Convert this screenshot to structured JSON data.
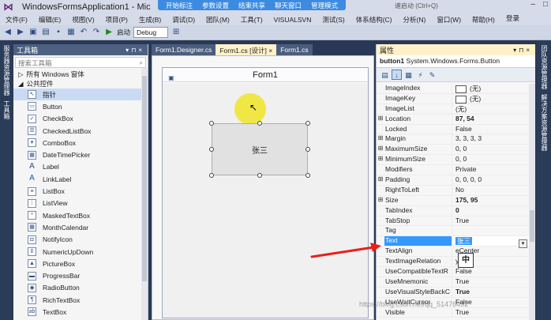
{
  "window": {
    "title": "WindowsFormsApplication1 - Mic",
    "quick_launch": "速启动 (Ctrl+Q)",
    "login": "登录",
    "win_controls": [
      "–",
      "□"
    ]
  },
  "screen_share_toolbar": [
    "开始标注",
    "参数设置",
    "结束共享",
    "聊天窗口",
    "管理模式"
  ],
  "menu": [
    "文件(F)",
    "编辑(E)",
    "视图(V)",
    "项目(P)",
    "生成(B)",
    "调试(D)",
    "团队(M)",
    "工具(T)",
    "VISUALSVN",
    "测试(S)",
    "体系结构(C)",
    "分析(N)",
    "窗口(W)",
    "帮助(H)"
  ],
  "toolbar": {
    "start_label": "启动",
    "config": "Debug"
  },
  "left_rail": [
    "服务器资源管理器",
    "工具箱"
  ],
  "right_rail": [
    "团队资源管理器",
    "解决方案资源管理器"
  ],
  "toolbox": {
    "title": "工具箱",
    "search_placeholder": "搜索工具箱",
    "groups": [
      "所有 Windows 窗体",
      "公共控件"
    ],
    "items": [
      "指针",
      "Button",
      "CheckBox",
      "CheckedListBox",
      "ComboBox",
      "DateTimePicker",
      "Label",
      "LinkLabel",
      "ListBox",
      "ListView",
      "MaskedTextBox",
      "MonthCalendar",
      "NotifyIcon",
      "NumericUpDown",
      "PictureBox",
      "ProgressBar",
      "RadioButton",
      "RichTextBox",
      "TextBox"
    ]
  },
  "doc_tabs": [
    "Form1.Designer.cs",
    "Form1.cs [设计]",
    "Form1.cs"
  ],
  "tab_close": "×",
  "form": {
    "title": "Form1",
    "button_text": "张三"
  },
  "properties": {
    "title": "属性",
    "object": "button1",
    "object_type": "System.Windows.Forms.Button",
    "rows": [
      {
        "name": "ImageIndex",
        "value": "(无)",
        "swatch": true,
        "exp": ""
      },
      {
        "name": "ImageKey",
        "value": "(无)",
        "swatch": true,
        "exp": ""
      },
      {
        "name": "ImageList",
        "value": "(无)",
        "exp": ""
      },
      {
        "name": "Location",
        "value": "87, 54",
        "bold": true,
        "exp": "⊞"
      },
      {
        "name": "Locked",
        "value": "False",
        "exp": ""
      },
      {
        "name": "Margin",
        "value": "3, 3, 3, 3",
        "exp": "⊞"
      },
      {
        "name": "MaximumSize",
        "value": "0, 0",
        "exp": "⊞"
      },
      {
        "name": "MinimumSize",
        "value": "0, 0",
        "exp": "⊞"
      },
      {
        "name": "Modifiers",
        "value": "Private",
        "exp": ""
      },
      {
        "name": "Padding",
        "value": "0, 0, 0, 0",
        "exp": "⊞"
      },
      {
        "name": "RightToLeft",
        "value": "No",
        "exp": ""
      },
      {
        "name": "Size",
        "value": "175, 95",
        "bold": true,
        "exp": "⊞"
      },
      {
        "name": "TabIndex",
        "value": "0",
        "bold": true,
        "exp": ""
      },
      {
        "name": "TabStop",
        "value": "True",
        "exp": ""
      },
      {
        "name": "Tag",
        "value": "",
        "exp": ""
      },
      {
        "name": "Text",
        "value": "张三",
        "highlight": true,
        "exp": ""
      },
      {
        "name": "TextAlign",
        "value": "eCenter",
        "exp": ""
      },
      {
        "name": "TextImageRelation",
        "value": "y",
        "exp": ""
      },
      {
        "name": "UseCompatibleTextR",
        "value": "False",
        "exp": ""
      },
      {
        "name": "UseMnemonic",
        "value": "True",
        "exp": ""
      },
      {
        "name": "UseVisualStyleBackC",
        "value": "True",
        "bold": true,
        "exp": ""
      },
      {
        "name": "UseWaitCursor",
        "value": "False",
        "exp": ""
      },
      {
        "name": "Visible",
        "value": "True",
        "exp": ""
      }
    ]
  },
  "ime_indicator": "中",
  "watermark": "https://blog.csdn.net/qq_51476492",
  "colors": {
    "accent": "#3399ff",
    "frame": "#293955",
    "annotation_arrow": "#e8201c",
    "highlight_spot": "#f0e428"
  }
}
